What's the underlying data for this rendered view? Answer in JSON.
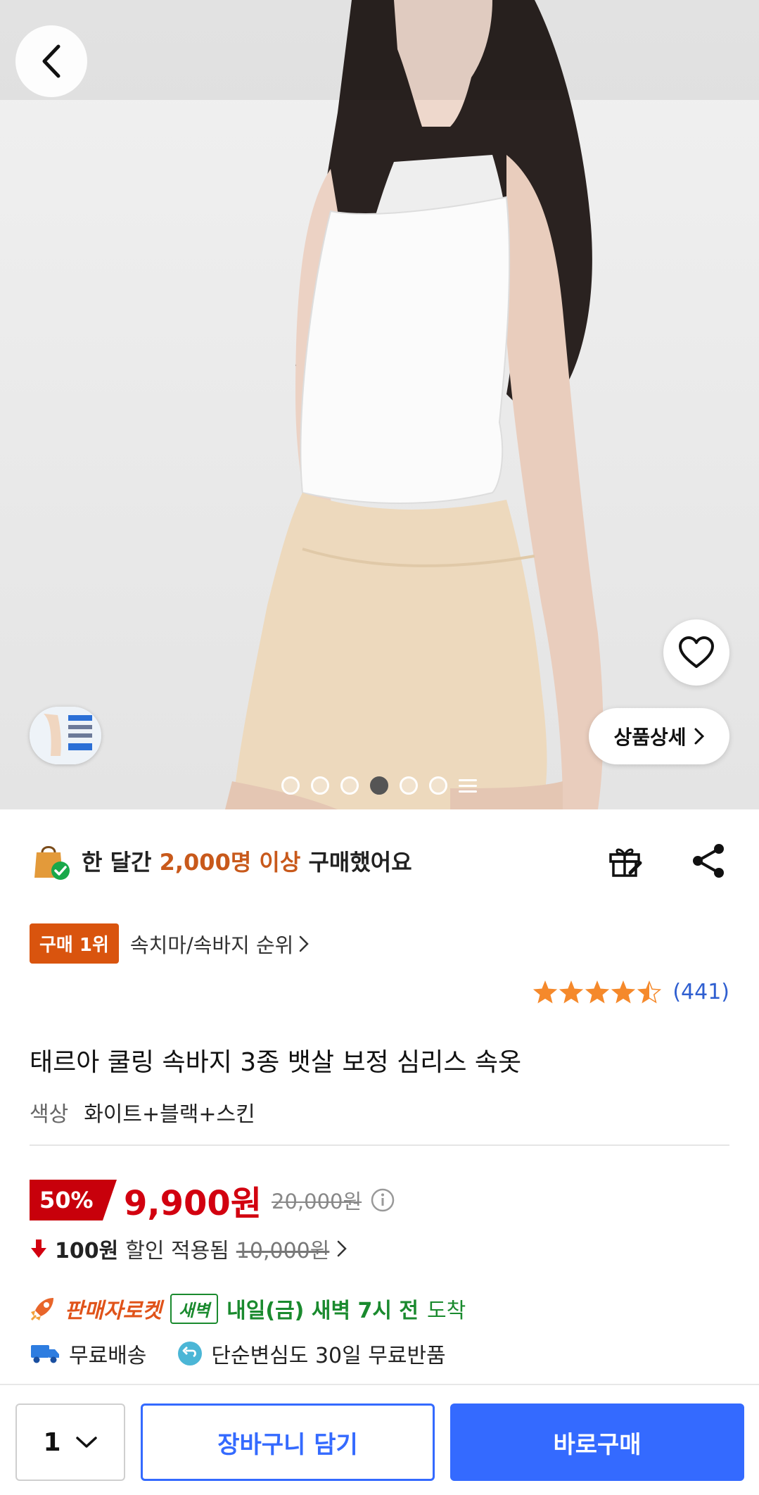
{
  "hero": {
    "image_subject": "product-photo-model",
    "dots_count": 6,
    "active_dot_index": 3,
    "detail_button_label": "상품상세"
  },
  "social_proof": {
    "prefix": "한 달간",
    "highlight": "2,000명 이상",
    "suffix": "구매했어요"
  },
  "ranking": {
    "badge": "구매 1위",
    "category": "속치마/속바지 순위"
  },
  "rating": {
    "stars": 4.5,
    "max": 5,
    "count": "(441)"
  },
  "product": {
    "title": "태르아 쿨링 속바지 3종 뱃살 보정 심리스 속옷",
    "option_label": "색상",
    "option_value": "화이트+블랙+스킨"
  },
  "price": {
    "discount": "50%",
    "current": "9,900원",
    "original": "20,000원"
  },
  "coupon": {
    "amount": "100원",
    "text": "할인 적용됨",
    "before": "10,000원"
  },
  "delivery": {
    "rocket_label": "판매자로켓",
    "dawn_badge": "새벽",
    "eta": "내일(금) 새벽 7시 전",
    "eta_suffix": "도착"
  },
  "shipping": {
    "free_shipping": "무료배송",
    "free_return": "단순변심도 30일 무료반품"
  },
  "bottom": {
    "quantity": "1",
    "cart_label": "장바구니 담기",
    "buy_label": "바로구매"
  },
  "colors": {
    "accent_blue": "#346aff",
    "price_red": "#d2000f",
    "rank_orange": "#d9540e",
    "dawn_green": "#1a8a2e",
    "star_orange": "#f5892b"
  }
}
